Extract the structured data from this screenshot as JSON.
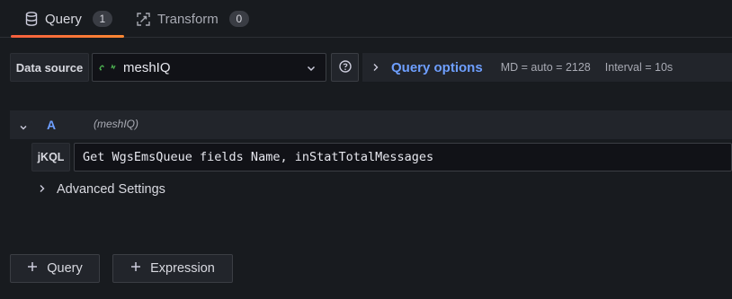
{
  "tabs": [
    {
      "label": "Query",
      "count": "1",
      "icon": "database-icon",
      "active": true
    },
    {
      "label": "Transform",
      "count": "0",
      "icon": "transform-icon",
      "active": false
    }
  ],
  "datasource": {
    "label": "Data source",
    "selected": "meshIQ",
    "logo": "meshiq-logo-icon"
  },
  "query_options": {
    "title": "Query options",
    "md": "MD = auto = 2128",
    "interval": "Interval = 10s"
  },
  "query": {
    "ref_id": "A",
    "datasource_hint": "(meshIQ)",
    "editor_label": "jKQL",
    "text": "Get WgsEmsQueue fields Name, inStatTotalMessages"
  },
  "advanced": {
    "label": "Advanced Settings"
  },
  "actions": {
    "add_query": "Query",
    "add_expression": "Expression"
  },
  "colors": {
    "accent": "#6e9fff",
    "tab_underline": "#f55f3e",
    "background": "#181b1f",
    "panel": "#22252b"
  }
}
